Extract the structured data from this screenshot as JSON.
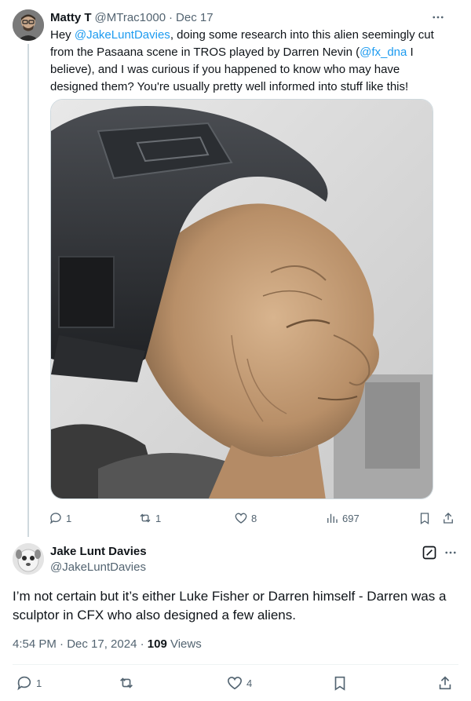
{
  "tweet1": {
    "name": "Matty T",
    "handle": "@MTrac1000",
    "dot": "·",
    "date": "Dec 17",
    "text": {
      "p1": "Hey ",
      "mention1": "@JakeLuntDavies",
      "p2": ", doing some research into this alien seemingly cut from the Pasaana scene in TROS played by Darren Nevin (",
      "mention2": "@fx_dna",
      "p3": " I believe), and I was curious if you happened to know who may have designed them? You're usually pretty well informed into stuff like this!"
    },
    "actions": {
      "replies": "1",
      "reposts": "1",
      "likes": "8",
      "views": "697"
    }
  },
  "tweet2": {
    "name": "Jake Lunt Davies",
    "handle": "@JakeLuntDavies",
    "text": "I’m not certain but it’s either Luke Fisher or Darren himself - Darren was a sculptor in CFX who also designed a few aliens.",
    "time": "4:54 PM · Dec 17, 2024 · ",
    "views_count": "109",
    "views_label": " Views",
    "actions": {
      "replies": "1",
      "likes": "4"
    }
  },
  "colors": {
    "accent": "#1d9bf0",
    "secondary_text": "#536471",
    "primary_text": "#0f1419",
    "border": "#cfd9de"
  },
  "icons": [
    "more-icon",
    "reply-icon",
    "repost-icon",
    "like-icon",
    "views-icon",
    "bookmark-icon",
    "share-icon",
    "grok-icon"
  ]
}
